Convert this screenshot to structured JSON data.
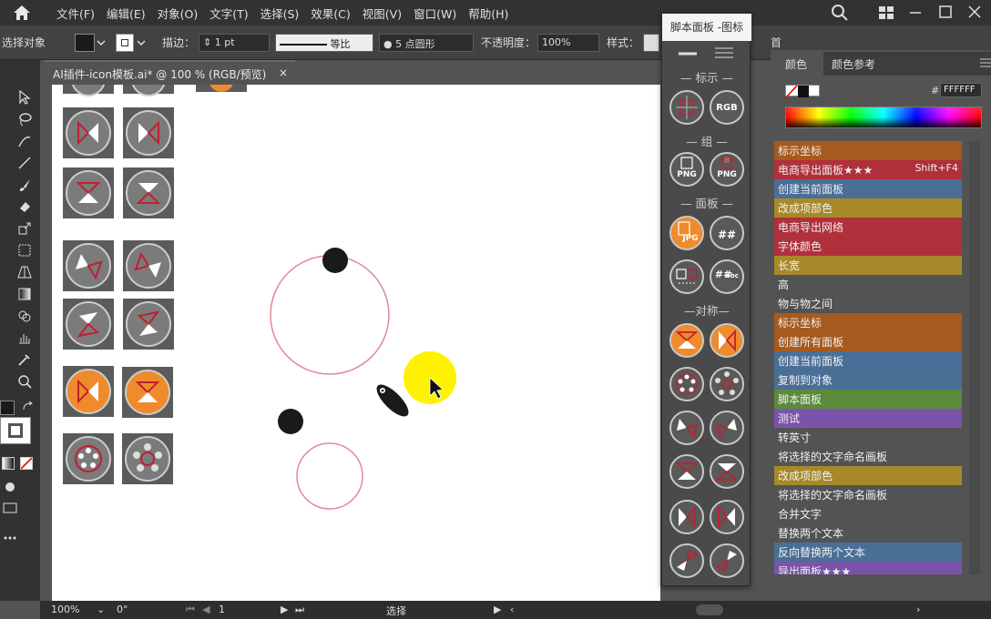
{
  "menu": [
    "文件(F)",
    "编辑(E)",
    "对象(O)",
    "文字(T)",
    "选择(S)",
    "效果(C)",
    "视图(V)",
    "窗口(W)",
    "帮助(H)"
  ],
  "control": {
    "mode": "选择对象",
    "stroke_label": "描边：",
    "stroke_weight": "1 pt",
    "profile": "等比",
    "brush": "5 点圆形",
    "opacity_label": "不透明度：",
    "opacity": "100%",
    "style_label": "样式：",
    "first": "首"
  },
  "document_tab": {
    "title": "AI插件-icon模板.ai* @ 100 % (RGB/预览)",
    "close": "×"
  },
  "script_panel": {
    "title": "脚本面板 -图标",
    "sections": [
      "— 标示 —",
      "— 组 —",
      "— 面板 —",
      "—对称—"
    ],
    "labels": {
      "rgb": "RGB",
      "png": "PNG",
      "png8": "8",
      "jpg": "JPG",
      "hash": "##",
      "abc": "abc"
    }
  },
  "color_panel": {
    "tab_color": "颜色",
    "tab_guide": "颜色参考",
    "hex_label": "#",
    "hex": "FFFFFF"
  },
  "actions": [
    {
      "label": "标示坐标",
      "color": "brown"
    },
    {
      "label": "电商导出面板★★★",
      "color": "red",
      "shortcut": "Shift+F4"
    },
    {
      "label": "创建当前面板",
      "color": "blue"
    },
    {
      "label": "改成项部色",
      "color": "olive"
    },
    {
      "label": "电商导出网络",
      "color": "red"
    },
    {
      "label": "字体颜色",
      "color": "red"
    },
    {
      "label": "长宽",
      "color": "olive"
    },
    {
      "label": "高",
      "color": "plain"
    },
    {
      "label": "物与物之间",
      "color": "plain"
    },
    {
      "label": "标示坐标",
      "color": "brown"
    },
    {
      "label": "创建所有面板",
      "color": "brown"
    },
    {
      "label": "创建当前面板",
      "color": "blue"
    },
    {
      "label": "复制到对象",
      "color": "blue"
    },
    {
      "label": "脚本面板",
      "color": "green"
    },
    {
      "label": "测试",
      "color": "purple"
    },
    {
      "label": "转英寸",
      "color": "plain"
    },
    {
      "label": "将选择的文字命名画板",
      "color": "plain"
    },
    {
      "label": "改成项部色",
      "color": "olive"
    },
    {
      "label": "将选择的文字命名画板",
      "color": "plain"
    },
    {
      "label": "合并文字",
      "color": "plain"
    },
    {
      "label": "替换两个文本",
      "color": "plain"
    },
    {
      "label": "反向替换两个文本",
      "color": "blue"
    },
    {
      "label": "导出面板★★★",
      "color": "purple"
    }
  ],
  "status": {
    "zoom": "100%",
    "rotate": "0°",
    "artboard": "1",
    "tool": "选择"
  },
  "colors": {
    "accent_orange": "#ef8b2c",
    "icon_red": "#c0202f",
    "cursor_yellow": "#fff200",
    "circle_stroke": "#e08a92"
  }
}
